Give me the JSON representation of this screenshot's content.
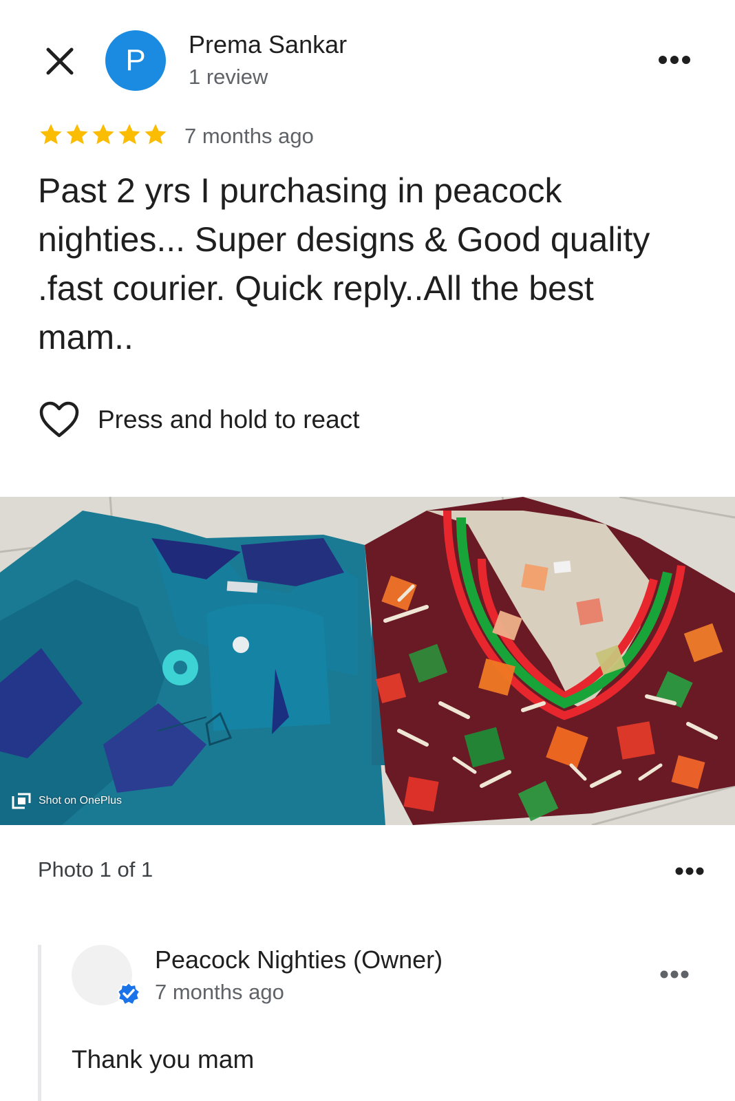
{
  "review": {
    "reviewer": {
      "initial": "P",
      "name": "Prema Sankar",
      "subtitle": "1 review",
      "avatar_color": "#1a8be0"
    },
    "rating": 5,
    "max_rating": 5,
    "star_color": "#fbbc04",
    "time": "7 months ago",
    "text": "Past 2 yrs I purchasing in peacock nighties... Super designs & Good quality .fast courier. Quick reply..All the best mam..",
    "react_label": "Press and hold to react"
  },
  "photo": {
    "watermark": "Shot on OnePlus",
    "counter": "Photo 1 of 1"
  },
  "owner_reply": {
    "name": "Peacock Nighties (Owner)",
    "time": "7 months ago",
    "text": "Thank you mam",
    "verified_color": "#1a73e8"
  },
  "icons": {
    "close": "close-icon",
    "more": "more-horizontal-icon",
    "star": "star-icon",
    "heart": "heart-outline-icon",
    "verified": "verified-badge-icon",
    "watermark": "oneplus-logo-icon"
  }
}
